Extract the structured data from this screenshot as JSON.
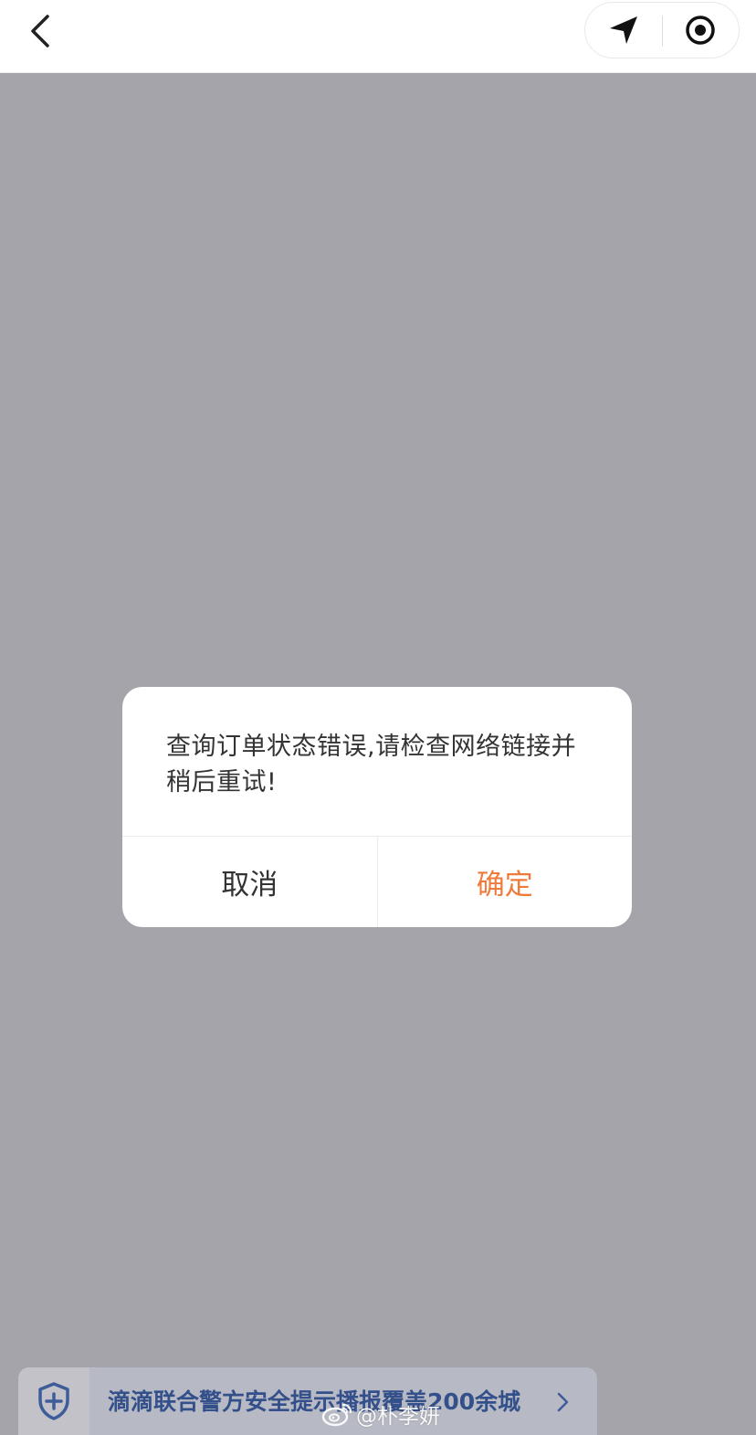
{
  "colors": {
    "overlay": "#a5a4aa",
    "confirm": "#ef7b3a",
    "banner_text": "#34508a"
  },
  "topbar": {
    "back_icon": "chevron-left-icon",
    "capsule": {
      "left_icon": "navigation-arrow-icon",
      "right_icon": "target-circle-icon"
    }
  },
  "dialog": {
    "message_line1": "查询订单状态错误,请检查网络链接并",
    "message_line2": "稍后重试!",
    "cancel_label": "取消",
    "confirm_label": "确定"
  },
  "banner": {
    "icon": "shield-plus-icon",
    "text": "滴滴联合警方安全提示播报覆盖200余城",
    "arrow_icon": "chevron-right-icon"
  },
  "watermark": {
    "logo": "weibo-logo",
    "text": "@朴李妍"
  }
}
